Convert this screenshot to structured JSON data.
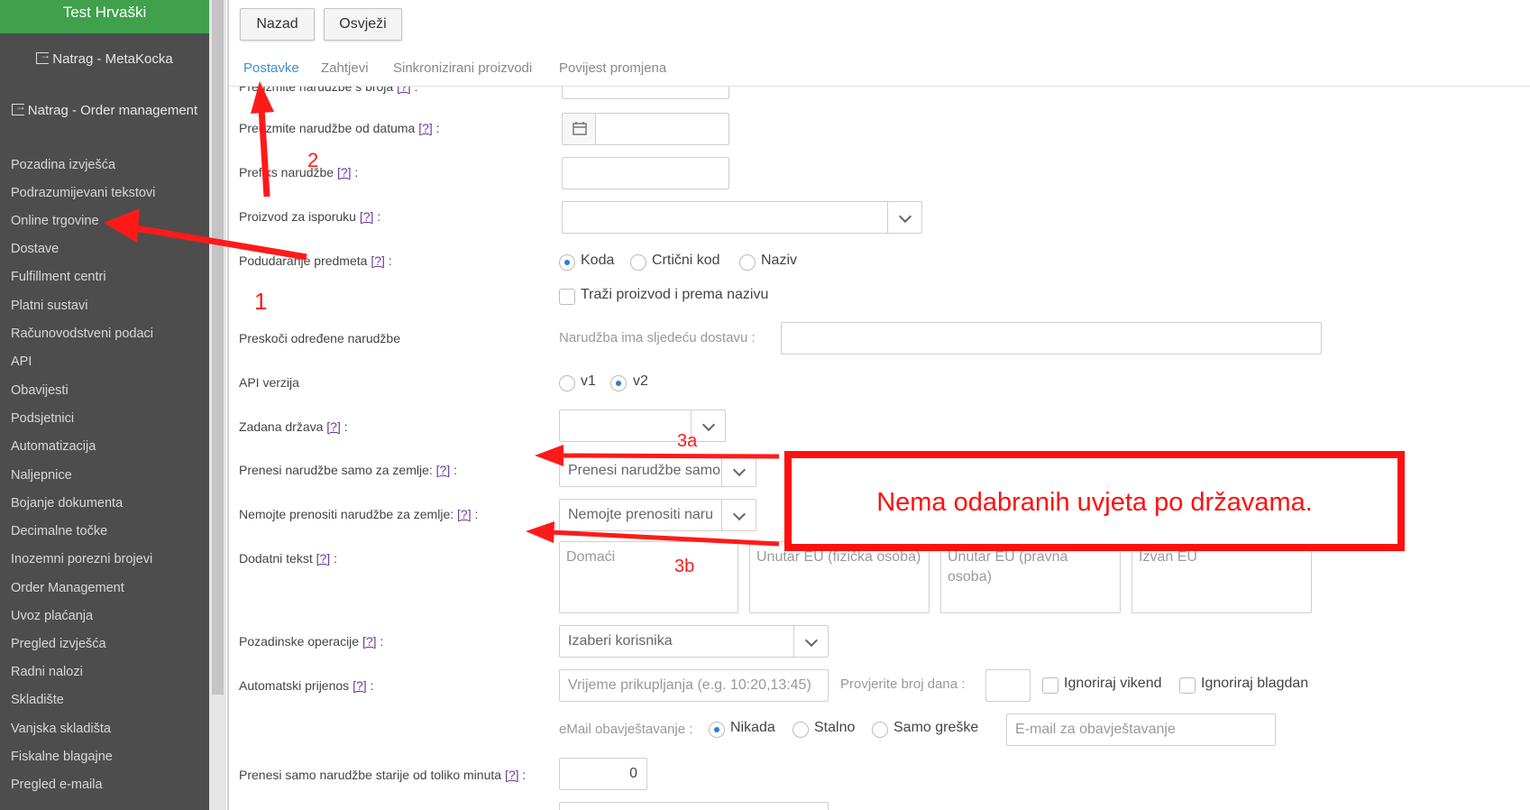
{
  "sidebar": {
    "title": "Test Hrvaški",
    "back_links": [
      "Natrag - MetaKocka",
      "Natrag - Order management"
    ],
    "items": [
      "Pozadina izvješća",
      "Podrazumijevani tekstovi",
      "Online trgovine",
      "Dostave",
      "Fulfillment centri",
      "Platni sustavi",
      "Računovodstveni podaci",
      "API",
      "Obavijesti",
      "Podsjetnici",
      "Automatizacija",
      "Naljepnice",
      "Bojanje dokumenta",
      "Decimalne točke",
      "Inozemni porezni brojevi",
      "Order Management",
      "Uvoz plaćanja",
      "Pregled izvješća",
      "Radni nalozi",
      "Skladište",
      "Vanjska skladišta",
      "Fiskalne blagajne",
      "Pregled e-maila"
    ]
  },
  "toolbar": {
    "back_label": "Nazad",
    "refresh_label": "Osvježi"
  },
  "tabs": [
    "Postavke",
    "Zahtjevi",
    "Sinkronizirani proizvodi",
    "Povijest promjena"
  ],
  "help": "[?]",
  "form": {
    "partial_label": "Preuzmite narudžbe s broja",
    "date_label": "Preuzmite narudžbe od datuma",
    "prefix_label": "Prefiks narudžbe",
    "delivery_product_label": "Proizvod za isporuku",
    "matching_label": "Podudaranje predmeta",
    "matching_options": [
      "Koda",
      "Crtični kod",
      "Naziv"
    ],
    "matching_selected": "Koda",
    "search_by_name_label": "Traži proizvod i prema nazivu",
    "skip_label": "Preskoči određene narudžbe",
    "skip_sub_label": "Narudžba ima sljedeću dostavu :",
    "api_label": "API verzija",
    "api_options": [
      "v1",
      "v2"
    ],
    "api_selected": "v2",
    "country_label": "Zadana država",
    "transfer_only_label": "Prenesi narudžbe samo za zemlje:",
    "transfer_only_value": "Prenesi narudžbe samo",
    "do_not_transfer_label": "Nemojte prenositi narudžbe za zemlje:",
    "do_not_transfer_value": "Nemojte prenositi naru",
    "extra_text_label": "Dodatni tekst",
    "extra_text_boxes": [
      "Domaći",
      "Unutar EU (fizička osoba)",
      "Unutar EU (pravna osoba)",
      "Izvan EU"
    ],
    "background_ops_label": "Pozadinske operacije",
    "background_ops_value": "Izaberi korisnika",
    "auto_transfer_label": "Automatski prijenos",
    "auto_transfer_placeholder": "Vrijeme prikupljanja (e.g. 10:20,13:45)",
    "check_days_label": "Provjerite broj dana :",
    "ignore_weekend": "Ignoriraj vikend",
    "ignore_holiday": "Ignoriraj blagdan",
    "email_notify_label": "eMail obavještavanje :",
    "email_options": [
      "Nikada",
      "Stalno",
      "Samo greške"
    ],
    "email_selected": "Nikada",
    "email_placeholder": "E-mail za obavještavanje",
    "older_than_label": "Prenesi samo narudžbe starije od toliko minuta",
    "older_than_value": "0"
  },
  "annotations": {
    "n1": "1",
    "n2": "2",
    "n3a": "3a",
    "n3b": "3b",
    "box_text": "Nema odabranih uvjeta po državama.",
    "color": "#ff1010"
  },
  "colors": {
    "sidebar_bg": "#4d4d4d",
    "title_bg": "#3fa14b",
    "accent": "#3d8fd1"
  }
}
